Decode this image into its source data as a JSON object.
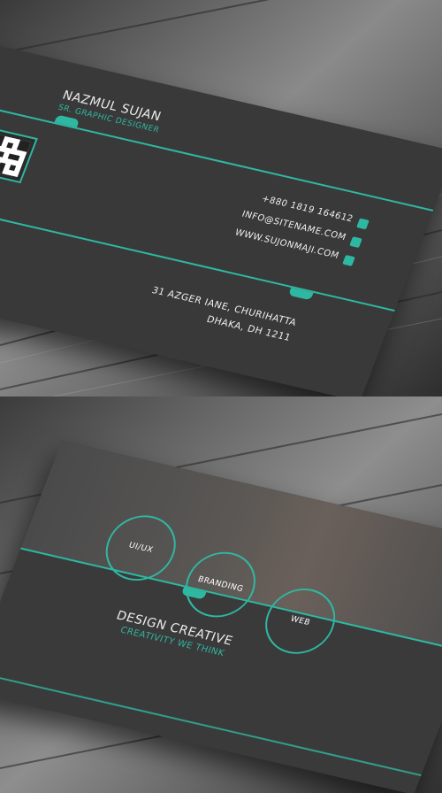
{
  "front": {
    "name": "NAZMUL SUJAN",
    "title": "SR. GRAPHIC DESIGNER",
    "phone": "+880 1819 164612",
    "email": "INFO@SITENAME.COM",
    "website": "WWW.SUJONMAJI.COM",
    "address_line1": "31 AZGER IANE, CHURIHATTA",
    "address_line2": "DHAKA, DH 1211"
  },
  "back": {
    "services": [
      "UI/UX",
      "BRANDING",
      "WEB"
    ],
    "headline": "DESIGN CREATIVE",
    "tagline": "CREATIVITY WE THINK"
  },
  "colors": {
    "accent": "#2fb8a1",
    "card": "#39393a",
    "wood": "#6e6e6e"
  },
  "icons": [
    "qr-code-icon",
    "phone-icon",
    "email-icon",
    "web-icon"
  ]
}
